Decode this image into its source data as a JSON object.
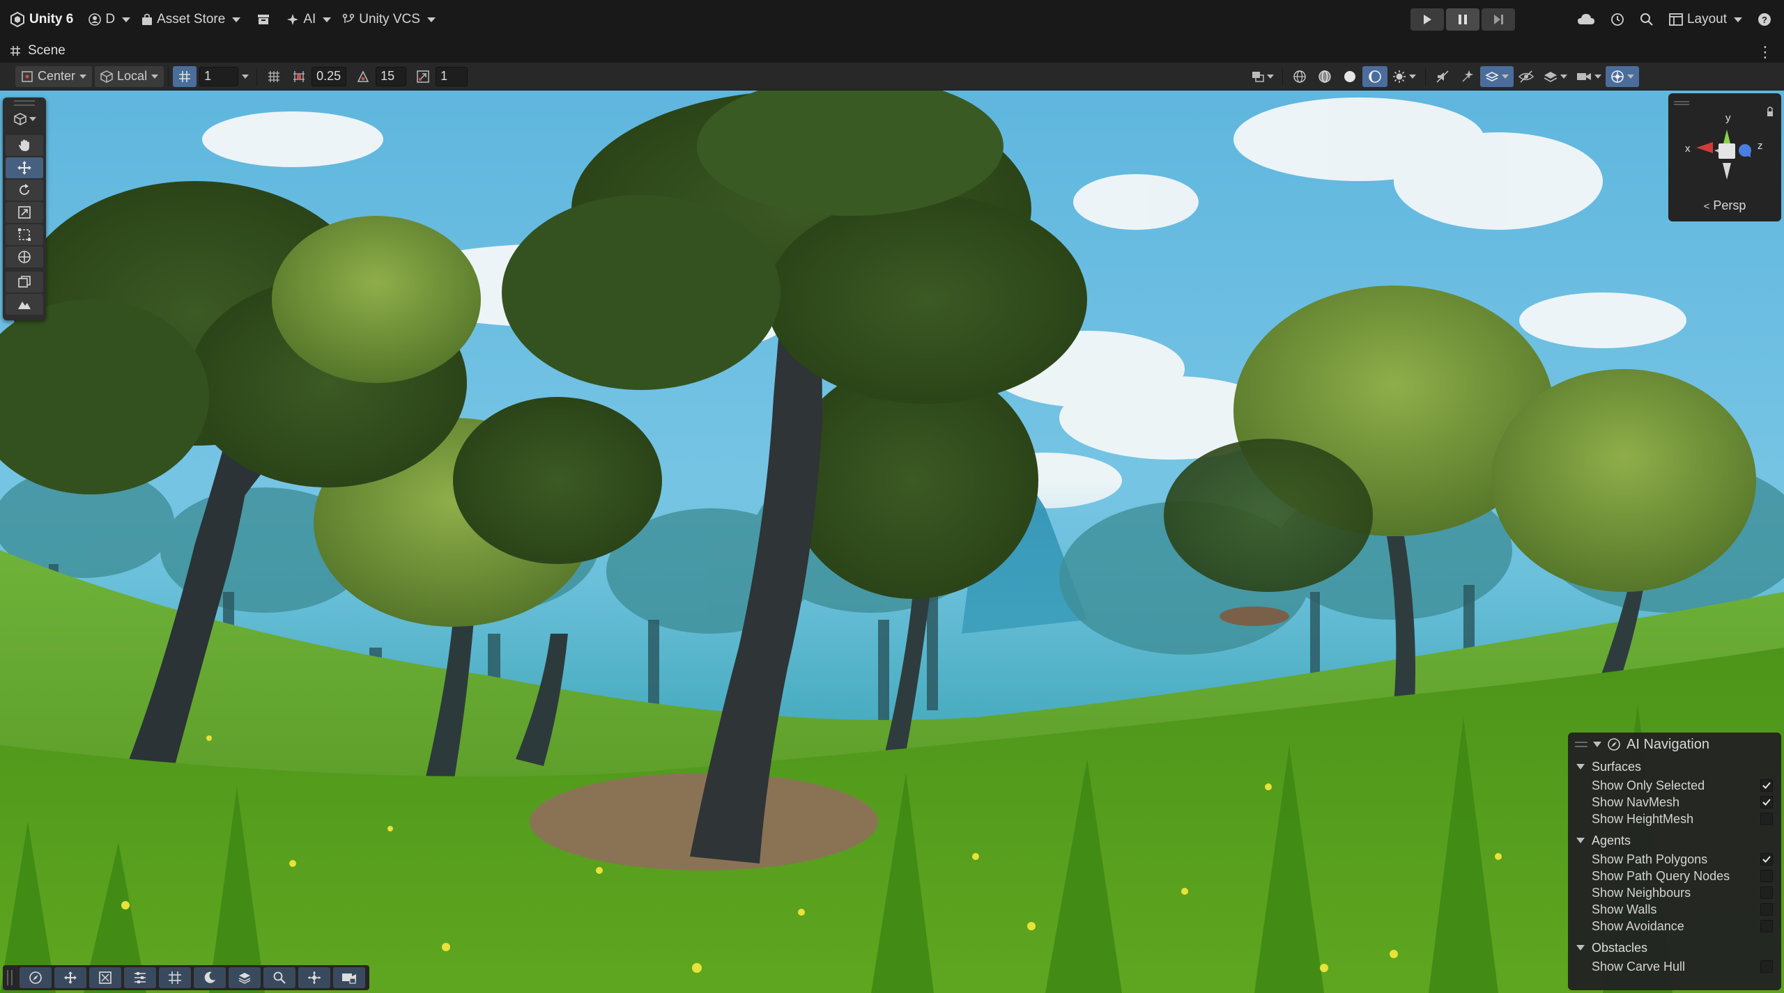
{
  "topbar": {
    "app_title": "Unity 6",
    "account_label": "D",
    "asset_store_label": "Asset Store",
    "ai_label": "AI",
    "vcs_label": "Unity VCS",
    "layout_label": "Layout"
  },
  "scene_tab": {
    "title": "Scene"
  },
  "scene_toolbar": {
    "pivot_label": "Center",
    "space_label": "Local",
    "grid_size": "1",
    "snap_increment": "0.25",
    "rotate_snap": "15",
    "scale_snap": "1"
  },
  "gizmo": {
    "projection_label": "Persp",
    "axis_x": "x",
    "axis_y": "y",
    "axis_z": "z"
  },
  "ai_navigation": {
    "title": "AI Navigation",
    "sections": [
      {
        "label": "Surfaces",
        "items": [
          {
            "label": "Show Only Selected",
            "checked": true
          },
          {
            "label": "Show NavMesh",
            "checked": true
          },
          {
            "label": "Show HeightMesh",
            "checked": false
          }
        ]
      },
      {
        "label": "Agents",
        "items": [
          {
            "label": "Show Path Polygons",
            "checked": true
          },
          {
            "label": "Show Path Query Nodes",
            "checked": false
          },
          {
            "label": "Show Neighbours",
            "checked": false
          },
          {
            "label": "Show Walls",
            "checked": false
          },
          {
            "label": "Show Avoidance",
            "checked": false
          }
        ]
      },
      {
        "label": "Obstacles",
        "items": [
          {
            "label": "Show Carve Hull",
            "checked": false
          }
        ]
      }
    ]
  },
  "colors": {
    "accent_blue": "#4a6d9c",
    "panel_bg": "#282828",
    "sky": "#63b6dc",
    "grass": "#4f9a1f"
  },
  "icons": {
    "bottom_toolbar": [
      "compass-icon",
      "move-icon",
      "scale-icon",
      "align-icon",
      "grid-icon",
      "moon-icon",
      "layers-icon",
      "search-icon",
      "snap-icon",
      "camera-icon"
    ]
  }
}
